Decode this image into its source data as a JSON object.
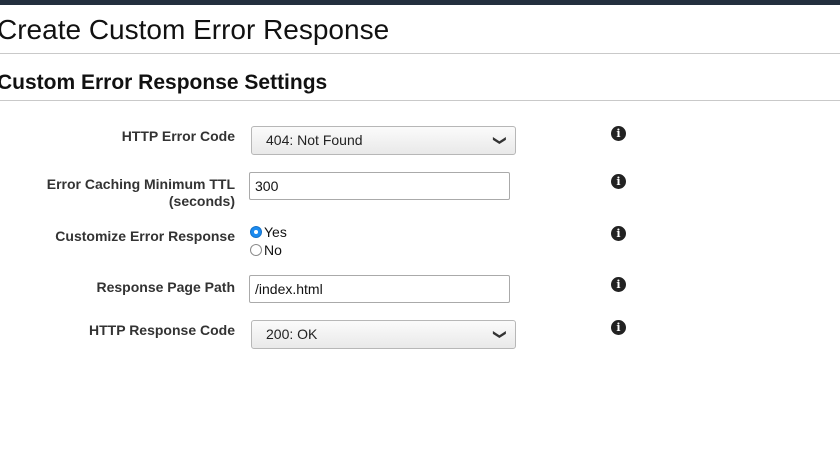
{
  "page": {
    "title": "Create Custom Error Response"
  },
  "section": {
    "title": "Custom Error Response Settings"
  },
  "form": {
    "http_error_code": {
      "label": "HTTP Error Code",
      "value": "404: Not Found"
    },
    "error_caching_ttl": {
      "label_line1": "Error Caching Minimum TTL",
      "label_line2": "(seconds)",
      "value": "300"
    },
    "customize_error_response": {
      "label": "Customize Error Response",
      "options": [
        "Yes",
        "No"
      ],
      "selected": "Yes"
    },
    "response_page_path": {
      "label": "Response Page Path",
      "value": "/index.html"
    },
    "http_response_code": {
      "label": "HTTP Response Code",
      "value": "200: OK"
    }
  },
  "icons": {
    "info": "info-icon",
    "dropdown": "chevron-down-icon"
  },
  "colors": {
    "topbar": "#232f3e",
    "radio_selected": "#1b8bf0"
  }
}
